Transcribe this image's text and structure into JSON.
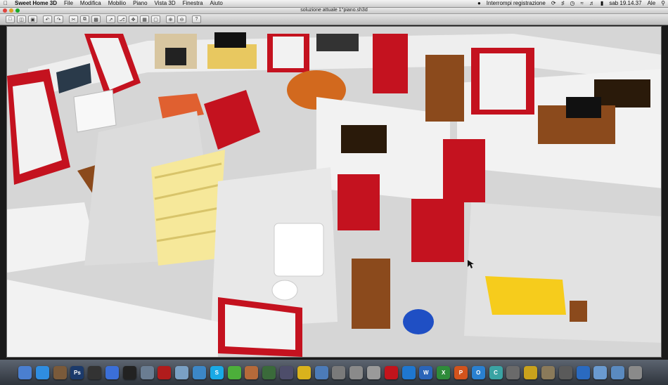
{
  "menubar": {
    "apple_icon": "apple-icon",
    "app_name": "Sweet Home 3D",
    "items": [
      "File",
      "Modifica",
      "Mobilio",
      "Piano",
      "Vista 3D",
      "Finestra",
      "Aiuto"
    ],
    "status_text": "Interrompi registrazione",
    "clock": "sab 19.14.37",
    "user": "Ale"
  },
  "window": {
    "title": "soluzione attuale 1°piano.sh3d"
  },
  "toolbar": {
    "buttons": [
      "new-icon",
      "open-icon",
      "save-icon",
      "undo-icon",
      "redo-icon",
      "cut-icon",
      "copy-icon",
      "paste-icon",
      "add-furniture-icon",
      "select-icon",
      "pan-icon",
      "create-walls-icon",
      "create-rooms-icon",
      "zoom-in-icon",
      "zoom-out-icon",
      "help-icon"
    ]
  },
  "view3d": {
    "wall_color": "#f2f2f2",
    "floor_color": "#d9d9d9",
    "accent_red": "#c4121f",
    "wood_color": "#8b4a1c",
    "stair_color": "#f6e89a"
  },
  "dock": {
    "apps": [
      {
        "icon": "finder-icon",
        "color": "#4a7fd0",
        "label": ""
      },
      {
        "icon": "safari-icon",
        "color": "#2f8de0",
        "label": ""
      },
      {
        "icon": "photo-icon",
        "color": "#7a5a3a",
        "label": ""
      },
      {
        "icon": "photoshop-icon",
        "color": "#1b3a6b",
        "label": "Ps"
      },
      {
        "icon": "movie-icon",
        "color": "#333333",
        "label": ""
      },
      {
        "icon": "itunes-icon",
        "color": "#3b6fd8",
        "label": ""
      },
      {
        "icon": "star-icon",
        "color": "#222222",
        "label": ""
      },
      {
        "icon": "preview-icon",
        "color": "#6a7d92",
        "label": ""
      },
      {
        "icon": "red-app-icon",
        "color": "#b11c1c",
        "label": ""
      },
      {
        "icon": "sweethome-icon",
        "color": "#7aa0c4",
        "label": ""
      },
      {
        "icon": "globe-icon",
        "color": "#3c87c7",
        "label": ""
      },
      {
        "icon": "skype-icon",
        "color": "#19a9e5",
        "label": "S"
      },
      {
        "icon": "utorrent-icon",
        "color": "#4caf3a",
        "label": ""
      },
      {
        "icon": "stamp-icon",
        "color": "#b56a3a",
        "label": ""
      },
      {
        "icon": "activity-icon",
        "color": "#3a6a3a",
        "label": ""
      },
      {
        "icon": "pen-icon",
        "color": "#4d4d6a",
        "label": ""
      },
      {
        "icon": "pie-chart-icon",
        "color": "#d9b21c",
        "label": ""
      },
      {
        "icon": "disk-icon",
        "color": "#4c7bb8",
        "label": ""
      },
      {
        "icon": "camera-icon",
        "color": "#7a7a7a",
        "label": ""
      },
      {
        "icon": "mail-icon",
        "color": "#8a8a8a",
        "label": ""
      },
      {
        "icon": "calendar-icon",
        "color": "#9a9a9a",
        "label": ""
      },
      {
        "icon": "puzzle-icon",
        "color": "#c2141c",
        "label": ""
      },
      {
        "icon": "upload-icon",
        "color": "#1f77d0",
        "label": ""
      },
      {
        "icon": "word-icon",
        "color": "#2a64b8",
        "label": "W"
      },
      {
        "icon": "excel-icon",
        "color": "#2e8b3a",
        "label": "X"
      },
      {
        "icon": "powerpoint-icon",
        "color": "#d2531c",
        "label": "P"
      },
      {
        "icon": "outlook-icon",
        "color": "#2a80d0",
        "label": "O"
      },
      {
        "icon": "communicator-icon",
        "color": "#3aa3a3",
        "label": "C"
      },
      {
        "icon": "cube-icon",
        "color": "#6a6a6a",
        "label": ""
      },
      {
        "icon": "warning-icon",
        "color": "#c9a21c",
        "label": ""
      },
      {
        "icon": "script-icon",
        "color": "#8a7a5a",
        "label": ""
      },
      {
        "icon": "keychain-icon",
        "color": "#5a5a5a",
        "label": ""
      },
      {
        "icon": "search-icon",
        "color": "#2a6ac0",
        "label": ""
      },
      {
        "icon": "folder-icon",
        "color": "#6a9ad0",
        "label": ""
      },
      {
        "icon": "downloads-icon",
        "color": "#5a8ac0",
        "label": ""
      },
      {
        "icon": "trash-icon",
        "color": "#8a8a8a",
        "label": ""
      }
    ]
  }
}
